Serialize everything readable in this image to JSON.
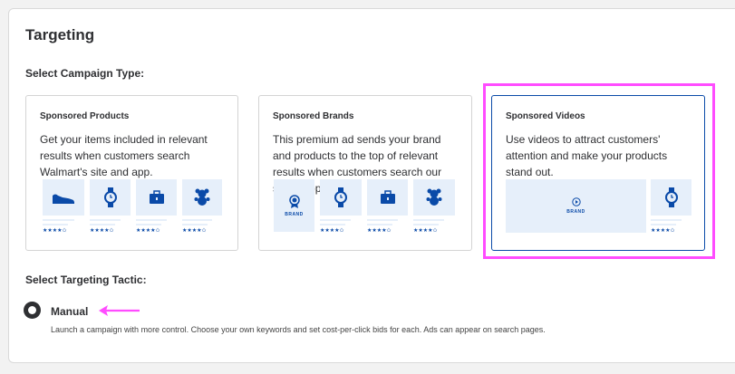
{
  "page": {
    "title": "Targeting",
    "campaign_type_label": "Select Campaign Type:",
    "targeting_tactic_label": "Select Targeting Tactic:"
  },
  "cards": [
    {
      "title": "Sponsored Products",
      "description": "Get your items included in relevant results when customers search Walmart's site and app.",
      "selected": false,
      "preview_icons": [
        "shoe-icon",
        "watch-icon",
        "briefcase-icon",
        "teddy-bear-icon"
      ],
      "stars": [
        "★★★★✩",
        "★★★★✩",
        "★★★★✩",
        "★★★★✩"
      ]
    },
    {
      "title": "Sponsored Brands",
      "description": "This premium ad sends your brand and products to the top of relevant results when customers search our site & app.",
      "selected": false,
      "brand_text": "BRAND",
      "preview_icons": [
        "award-icon",
        "watch-icon",
        "briefcase-icon",
        "teddy-bear-icon"
      ],
      "stars": [
        "★★★★✩",
        "★★★★✩",
        "★★★★✩"
      ]
    },
    {
      "title": "Sponsored Videos",
      "description": "Use videos to attract customers' attention and make your products stand out.",
      "selected": true,
      "brand_text": "BRAND",
      "preview_icons": [
        "play-icon",
        "watch-icon"
      ],
      "stars": [
        "★★★★✩"
      ]
    }
  ],
  "tactic": {
    "label": "Manual",
    "description": "Launch a campaign with more control. Choose your own keywords and set cost-per-click bids for each. Ads can appear on search pages.",
    "selected": true
  },
  "colors": {
    "accent": "#0a4aa8",
    "tile_bg": "#e6effa",
    "annotation": "#ff4cff"
  }
}
